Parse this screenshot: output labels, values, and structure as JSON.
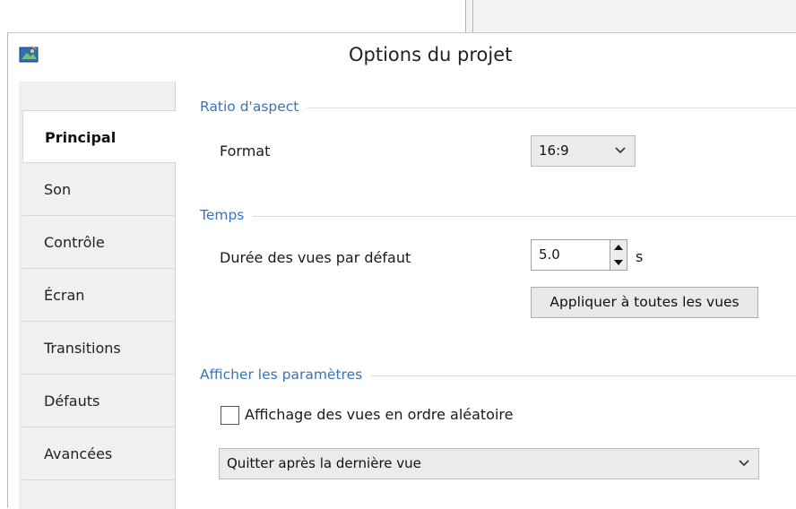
{
  "window": {
    "title": "Options du projet",
    "icon": "app-logo-icon"
  },
  "tabs": [
    {
      "label": "Principal",
      "active": true
    },
    {
      "label": "Son"
    },
    {
      "label": "Contrôle"
    },
    {
      "label": "Écran"
    },
    {
      "label": "Transitions"
    },
    {
      "label": "Défauts"
    },
    {
      "label": "Avancées"
    }
  ],
  "aspect": {
    "group_title": "Ratio d'aspect",
    "format_label": "Format",
    "format_value": "16:9"
  },
  "time": {
    "group_title": "Temps",
    "duration_label": "Durée des vues par défaut",
    "duration_value": "5.0",
    "unit": "s",
    "apply_button": "Appliquer à toutes les vues"
  },
  "display": {
    "group_title": "Afficher les paramètres",
    "random_label": "Affichage des vues en ordre aléatoire",
    "random_checked": false,
    "end_action": "Quitter après la dernière vue"
  },
  "colors": {
    "accent": "#3a73b8",
    "sidebar": "#f0f0f0",
    "control": "#ebebeb"
  }
}
